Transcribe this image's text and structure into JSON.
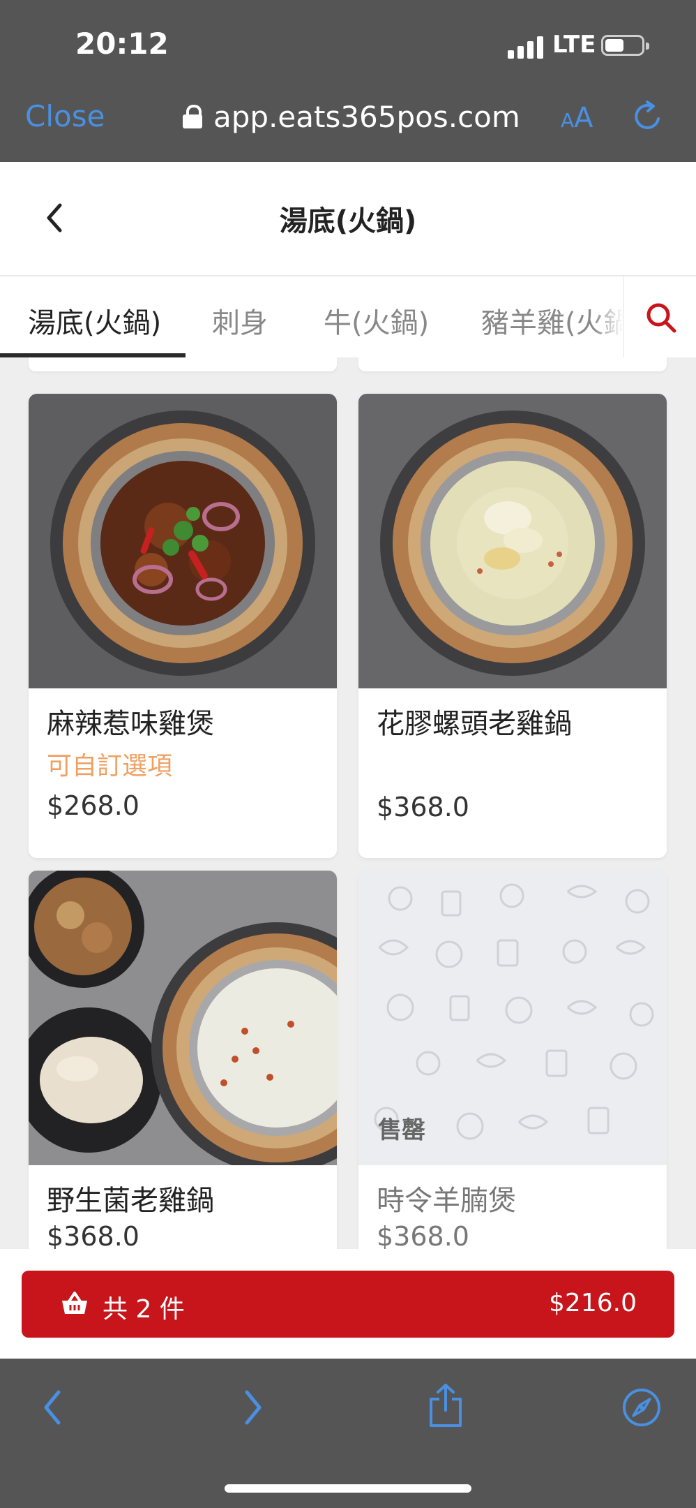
{
  "status_bar": {
    "time": "20:12",
    "network": "LTE"
  },
  "browser": {
    "close_label": "Close",
    "url": "app.eats365pos.com",
    "text_size_small": "A",
    "text_size_big": "A"
  },
  "header": {
    "title": "湯底(火鍋)"
  },
  "tabs": [
    {
      "label": "湯底(火鍋)",
      "active": true
    },
    {
      "label": "刺身",
      "active": false
    },
    {
      "label": "牛(火鍋)",
      "active": false
    },
    {
      "label": "豬羊雞(火鍋)",
      "active": false
    }
  ],
  "items": [
    {
      "name": "麻辣惹味雞煲",
      "option_note": "可自訂選項",
      "price": "$268.0"
    },
    {
      "name": "花膠螺頭老雞鍋",
      "price": "$368.0"
    },
    {
      "name": "野生菌老雞鍋",
      "price": "$368.0"
    },
    {
      "name": "時令羊腩煲",
      "price": "$368.0",
      "badge": "售罄"
    }
  ],
  "cart": {
    "count_label": "共 2 件",
    "total": "$216.0"
  },
  "colors": {
    "accent_red": "#c8151b",
    "link_blue": "#4a90e2",
    "option_orange": "#f0a060",
    "chrome_gray": "#555555"
  }
}
